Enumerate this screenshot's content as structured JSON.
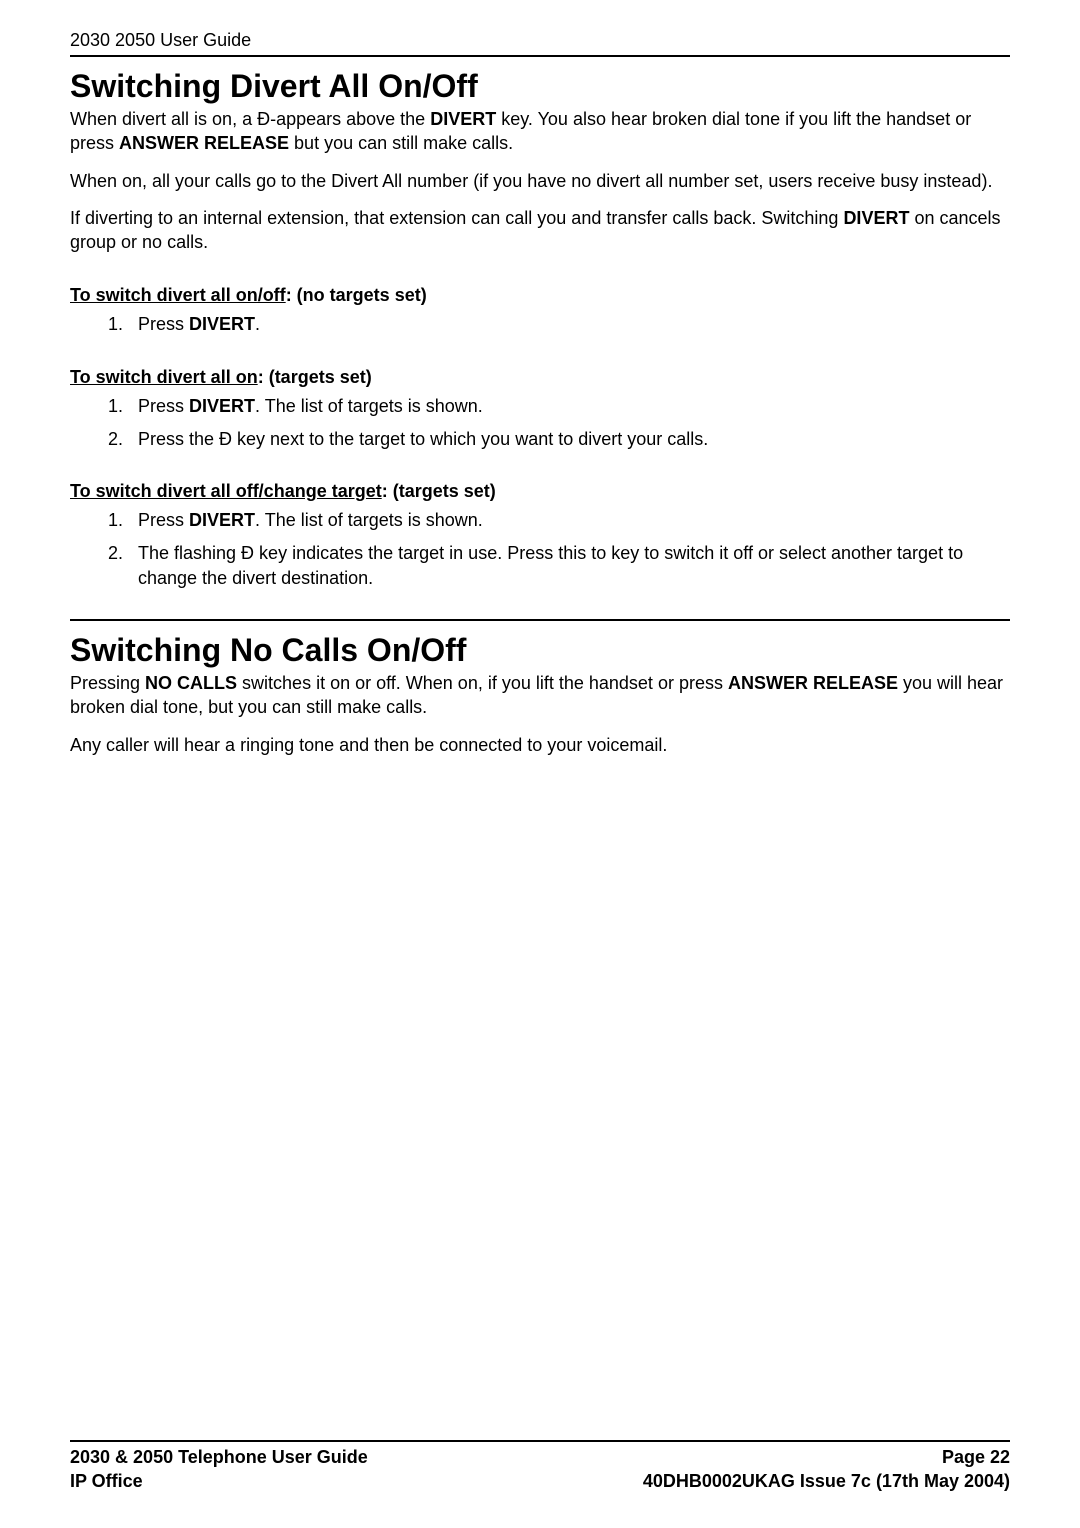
{
  "header": {
    "title": "2030 2050 User Guide"
  },
  "section1": {
    "heading": "Switching Divert All On/Off",
    "p1_a": "When divert all is on, a Ð-appears above the ",
    "p1_b": "DIVERT",
    "p1_c": " key. You also hear broken dial tone if you lift the handset or press ",
    "p1_d": "ANSWER RELEASE",
    "p1_e": " but you can still make calls.",
    "p2": "When on, all your calls go to the Divert All number (if you have no divert all number set, users receive busy instead).",
    "p3_a": "If diverting to an internal extension, that extension can call you and transfer calls back. Switching ",
    "p3_b": "DIVERT",
    "p3_c": " on cancels group or no calls.",
    "sub1": {
      "label_u": "To switch divert all on/off",
      "label_rest": ": (no targets set)",
      "step1_a": "Press ",
      "step1_b": "DIVERT",
      "step1_c": "."
    },
    "sub2": {
      "label_u": "To switch divert all on",
      "label_rest": ": (targets set)",
      "step1_a": "Press ",
      "step1_b": "DIVERT",
      "step1_c": ". The list of targets is shown.",
      "step2": "Press the Ð key next to the target to which you want to divert your calls."
    },
    "sub3": {
      "label_u": "To switch divert all off/change target",
      "label_rest": ": (targets set)",
      "step1_a": "Press ",
      "step1_b": "DIVERT",
      "step1_c": ". The list of targets is shown.",
      "step2": "The flashing Ð key indicates the target in use. Press this to key to switch it off or select another target to change the divert destination."
    }
  },
  "section2": {
    "heading": "Switching No Calls On/Off",
    "p1_a": "Pressing ",
    "p1_b": "NO CALLS",
    "p1_c": " switches it on or off. When on, if you lift the handset or press ",
    "p1_d": "ANSWER RELEASE",
    "p1_e": " you will hear broken dial tone, but you can still make calls.",
    "p2": "Any caller will hear a ringing tone and then be connected to your voicemail."
  },
  "footer": {
    "left1": "2030 & 2050 Telephone User Guide",
    "right1": "Page 22",
    "left2": "IP Office",
    "right2": "40DHB0002UKAG Issue 7c (17th May 2004)"
  }
}
